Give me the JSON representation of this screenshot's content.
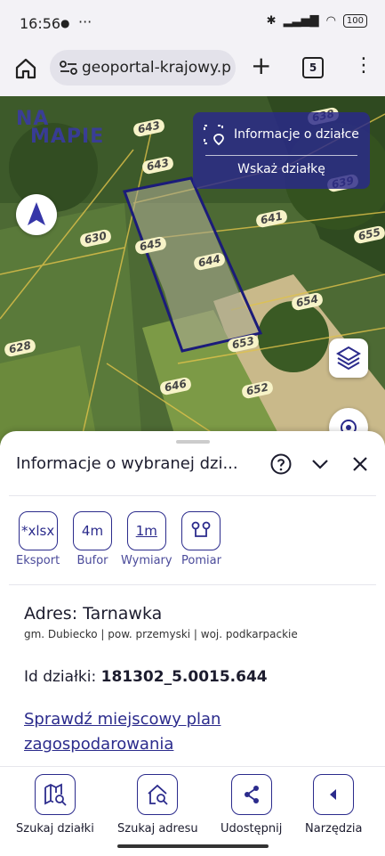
{
  "status_bar": {
    "time": "16:56",
    "battery": "100"
  },
  "browser": {
    "url": "geoportal-krajowy.pl",
    "tab_count": "5"
  },
  "map": {
    "logo": [
      "NA",
      "MAPIE"
    ],
    "parcels": [
      "643",
      "643",
      "638",
      "639",
      "630",
      "645",
      "644",
      "641",
      "655",
      "654",
      "628",
      "653",
      "646",
      "652"
    ],
    "info_panel": {
      "plot_info": "Informacje o działce",
      "point_plot": "Wskaż działkę"
    }
  },
  "sheet": {
    "title": "Informacje o wybranej dzi...",
    "tools": [
      {
        "icon": "*xlsx",
        "label": "Eksport"
      },
      {
        "icon": "4m",
        "label": "Bufor"
      },
      {
        "icon": "1m",
        "label": "Wymiary"
      },
      {
        "icon": "",
        "label": "Pomiar"
      }
    ],
    "address": "Adres: Tarnawka",
    "address_details": "gm. Dubiecko | pow. przemyski | woj. podkarpackie",
    "plot_id_label": "Id działki:",
    "plot_id_value": "181302_5.0015.644",
    "plan_link": "Sprawdź miejscowy plan zagospodarowania"
  },
  "bottom_nav": [
    {
      "label": "Szukaj działki"
    },
    {
      "label": "Szukaj adresu"
    },
    {
      "label": "Udostępnij"
    },
    {
      "label": "Narzędzia"
    }
  ],
  "colors": {
    "accent": "#2b2b8c",
    "panel": "#2a288c"
  }
}
